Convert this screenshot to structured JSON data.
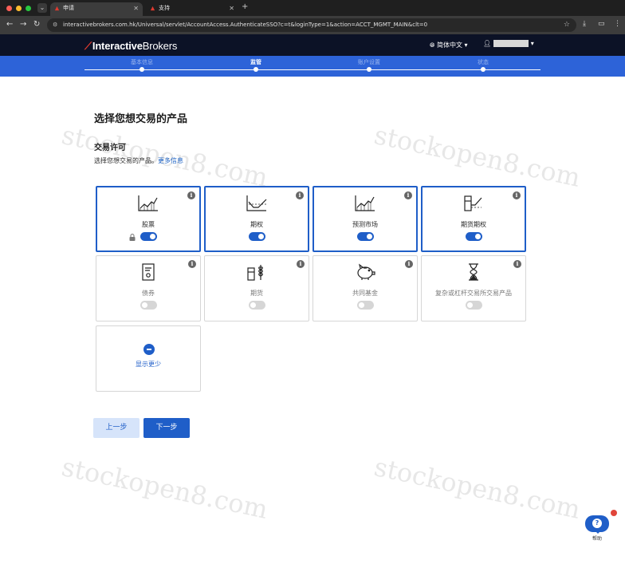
{
  "browser": {
    "tabs": [
      {
        "title": "申请",
        "active": true
      },
      {
        "title": "支持",
        "active": false
      }
    ],
    "url": "interactivebrokers.com.hk/Universal/servlet/AccountAccess.AuthenticateSSO?c=t&loginType=1&action=ACCT_MGMT_MAIN&clt=0"
  },
  "header": {
    "logo_bold": "Interactive",
    "logo_light": "Brokers",
    "language": "简体中文",
    "user_name": ""
  },
  "stepper": {
    "steps": [
      {
        "label": "基本信息",
        "current": false
      },
      {
        "label": "监管",
        "current": true
      },
      {
        "label": "账户设置",
        "current": false
      },
      {
        "label": "状态",
        "current": false
      }
    ]
  },
  "main": {
    "title": "选择您想交易的产品",
    "section_title": "交易许可",
    "section_desc": "选择您想交易的产品。",
    "more_info_link": "更多信息",
    "products": [
      {
        "label": "股票",
        "icon": "stock-chart-icon",
        "enabled": true,
        "locked": true
      },
      {
        "label": "期权",
        "icon": "options-icon",
        "enabled": true,
        "locked": false
      },
      {
        "label": "预测市场",
        "icon": "prediction-market-icon",
        "enabled": true,
        "locked": false
      },
      {
        "label": "期货期权",
        "icon": "futures-options-icon",
        "enabled": true,
        "locked": false
      },
      {
        "label": "债券",
        "icon": "bond-document-icon",
        "enabled": false,
        "locked": false
      },
      {
        "label": "期货",
        "icon": "futures-wheat-icon",
        "enabled": false,
        "locked": false
      },
      {
        "label": "共同基金",
        "icon": "piggy-bank-icon",
        "enabled": false,
        "locked": false
      },
      {
        "label": "复杂或杠杆交易所交易产品",
        "icon": "hourglass-icon",
        "enabled": false,
        "locked": false
      }
    ],
    "show_less_label": "显示更少",
    "back_button": "上一步",
    "next_button": "下一步"
  },
  "watermark": "stockopen8.com",
  "help_label": "帮助",
  "colors": {
    "brand_blue": "#1f5ec8",
    "stepper_blue": "#2d63d8",
    "header_navy": "#0c1226",
    "logo_red": "#e03a2f"
  }
}
